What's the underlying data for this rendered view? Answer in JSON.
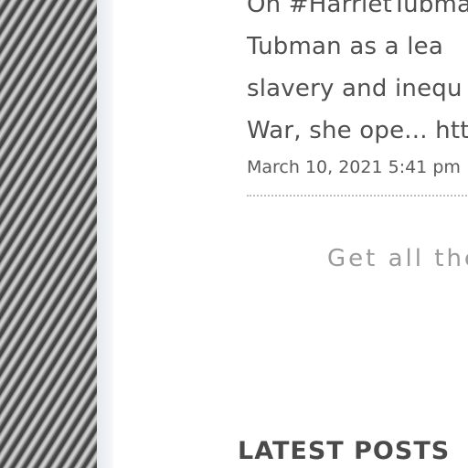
{
  "tweet": {
    "lines": [
      "On #HarrietTubman",
      "Tubman as a lea",
      "slavery and inequ",
      "War, she ope... htt"
    ],
    "date": "March 10, 2021 5:41 pm"
  },
  "newsletter": {
    "cta": "Get all the"
  },
  "sidebar": {
    "latest_posts_heading": "LATEST POSTS"
  }
}
